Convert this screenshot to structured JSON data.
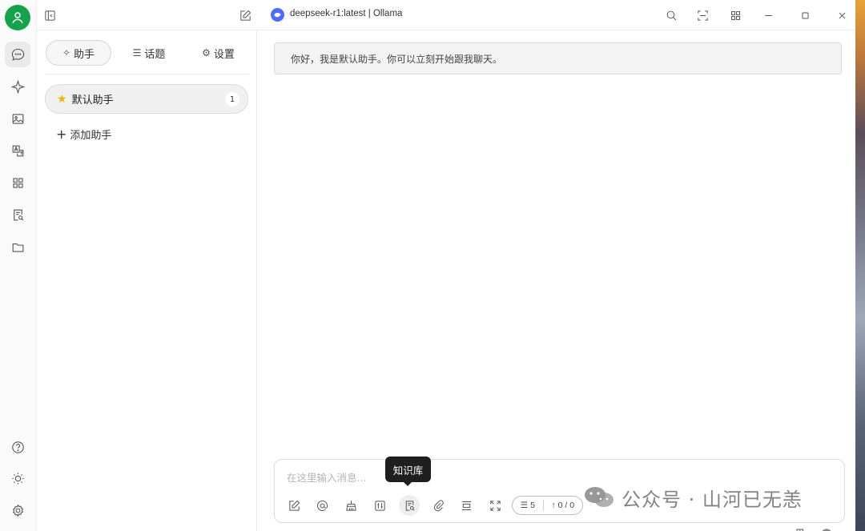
{
  "topbar": {
    "model_title": "deepseek-r1:latest | Ollama",
    "icons": [
      "sidebar-toggle-icon",
      "edit-icon",
      "search-icon",
      "scan-icon",
      "apps-icon",
      "minimize-icon",
      "maximize-icon",
      "close-icon"
    ]
  },
  "rail": {
    "items": [
      "chat-icon",
      "sparkle-icon",
      "image-icon",
      "translate-icon",
      "apps-icon",
      "knowledge-icon",
      "folder-icon"
    ],
    "bottom": [
      "help-icon",
      "theme-icon",
      "settings-icon"
    ]
  },
  "panel": {
    "tabs": {
      "assistant": "助手",
      "topics": "话题",
      "settings": "设置"
    },
    "assistant_item": {
      "name": "默认助手",
      "count": "1"
    },
    "add_assistant": "添加助手"
  },
  "chat": {
    "greeting": "你好，我是默认助手。你可以立刻开始跟我聊天。",
    "composer": {
      "placeholder": "在这里输入消息...",
      "tooltip": "知识库",
      "context_count": "5",
      "token_count": "0 / 0"
    }
  },
  "watermark": {
    "text": "公众号 · 山河已无恙"
  },
  "colors": {
    "avatar": "#14a34a",
    "model_logo": "#4d6bfe",
    "tooltip_bg": "#1f1f1f"
  }
}
